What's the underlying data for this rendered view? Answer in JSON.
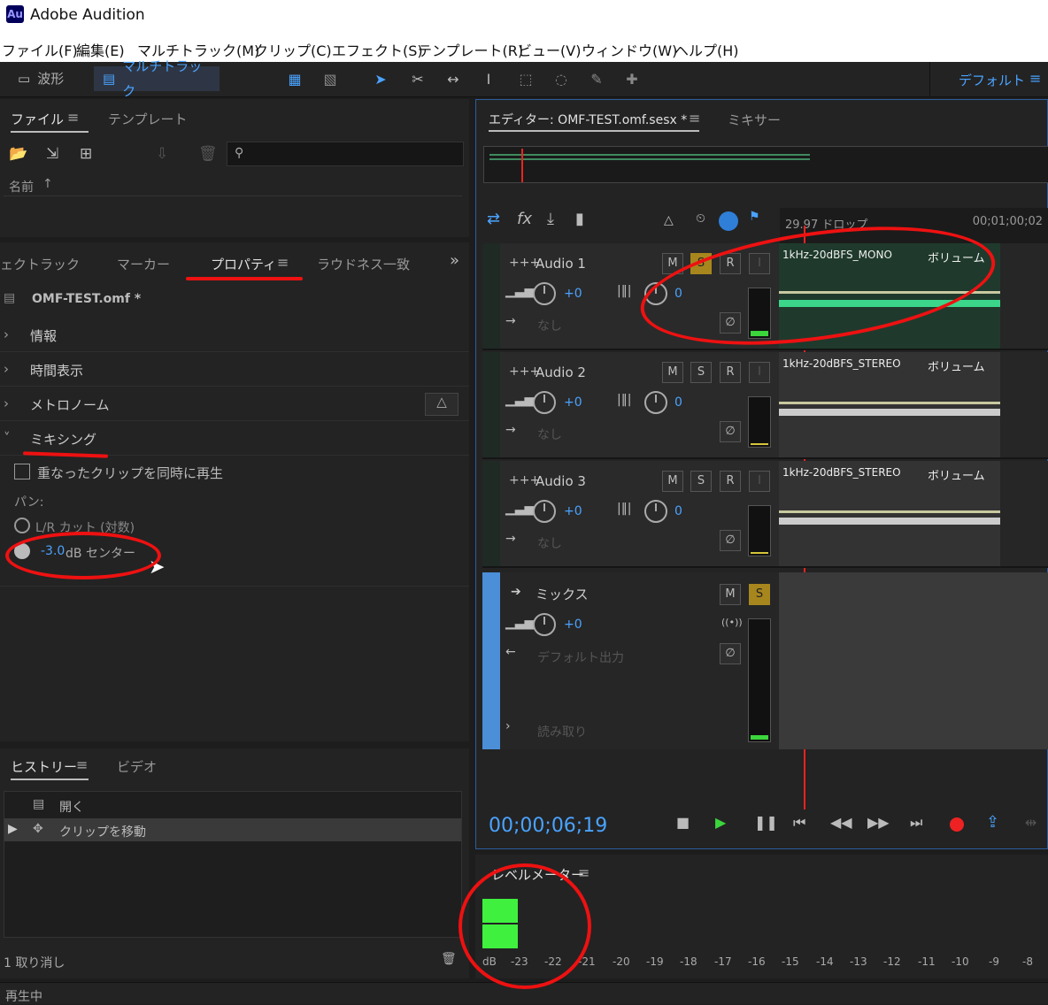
{
  "app": {
    "logo": "Au",
    "title": "Adobe Audition"
  },
  "menu": [
    "ファイル(F)",
    "編集(E)",
    "マルチトラック(M)",
    "クリップ(C)",
    "エフェクト(S)",
    "テンプレート(R)",
    "ビュー(V)",
    "ウィンドウ(W)",
    "ヘルプ(H)"
  ],
  "toolbar": {
    "waveform": "波形",
    "multitrack": "マルチトラック",
    "workspace": "デフォルト"
  },
  "files_panel": {
    "tab_files": "ファイル",
    "tab_templates": "テンプレート",
    "column_name": "名前"
  },
  "props_panel": {
    "tabs": [
      "ェクトラック",
      "マーカー",
      "プロパティ",
      "ラウドネス一致"
    ],
    "file": "OMF-TEST.omf *",
    "sections": [
      "情報",
      "時間表示",
      "メトロノーム",
      "ミキシング"
    ],
    "overlap_label": "重なったクリップを同時に再生",
    "pan_label": "パン:",
    "pan_opt1": "L/R カット (対数)",
    "pan_opt2_value": "-3.0",
    "pan_opt2_label": "dB センター"
  },
  "history_panel": {
    "tab_history": "ヒストリー",
    "tab_video": "ビデオ",
    "items": [
      "開く",
      "クリップを移動"
    ],
    "undo_count": "1 取り消し"
  },
  "status": "再生中",
  "editor": {
    "tab_editor": "エディター: OMF-TEST.omf.sesx *",
    "tab_mixer": "ミキサー",
    "ruler_left": "29.97 ドロップ",
    "ruler_right": "00;01;00;02",
    "timecode": "00;00;06;19",
    "tracks": [
      {
        "name": "Audio 1",
        "vol": "+0",
        "pan": "0",
        "input": "なし",
        "clip": "1kHz-20dBFS_MONO",
        "volume": "ボリューム"
      },
      {
        "name": "Audio 2",
        "vol": "+0",
        "pan": "0",
        "input": "なし",
        "clip": "1kHz-20dBFS_STEREO",
        "volume": "ボリューム"
      },
      {
        "name": "Audio 3",
        "vol": "+0",
        "pan": "0",
        "input": "なし",
        "clip": "1kHz-20dBFS_STEREO",
        "volume": "ボリューム"
      }
    ],
    "mix": {
      "name": "ミックス",
      "vol": "+0",
      "output": "デフォルト出力",
      "automation": "読み取り"
    },
    "btn_m": "M",
    "btn_s": "S",
    "btn_r": "R",
    "btn_i": "I"
  },
  "level_meter": {
    "title": "レベルメーター",
    "scale": [
      "dB",
      "-23",
      "-22",
      "-21",
      "-20",
      "-19",
      "-18",
      "-17",
      "-16",
      "-15",
      "-14",
      "-13",
      "-12",
      "-11",
      "-10",
      "-9",
      "-8"
    ]
  }
}
